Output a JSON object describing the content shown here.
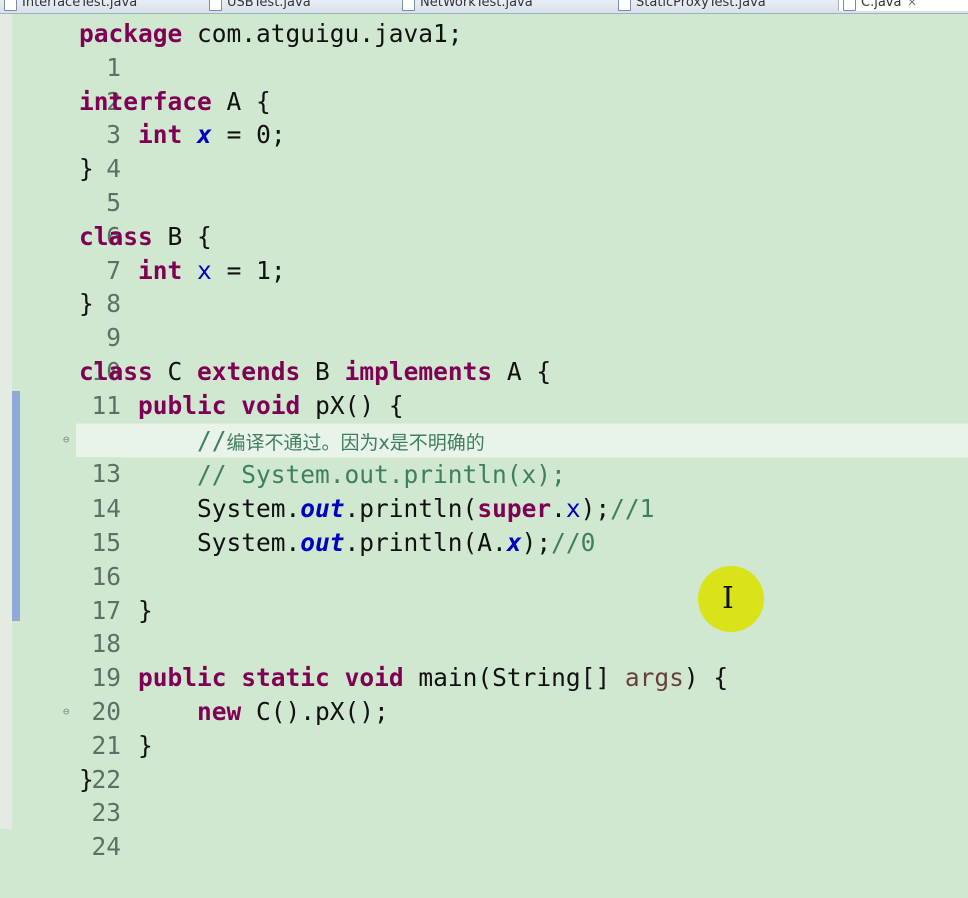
{
  "tabs": [
    {
      "label": "InterfaceTest.java",
      "active": false
    },
    {
      "label": "USBTest.java",
      "active": false
    },
    {
      "label": "NetWorkTest.java",
      "active": false
    },
    {
      "label": "StaticProxyTest.java",
      "active": false
    },
    {
      "label": "C.java",
      "active": true
    }
  ],
  "code": {
    "l1": {
      "num": "1",
      "a": "package",
      "b": " com.atguigu.java1;"
    },
    "l2": {
      "num": "2"
    },
    "l3": {
      "num": "3",
      "a": "interface",
      "b": " A {"
    },
    "l4": {
      "num": "4",
      "a": "int",
      "b": " ",
      "c": "x",
      "d": " = 0;"
    },
    "l5": {
      "num": "5",
      "a": "}"
    },
    "l6": {
      "num": "6"
    },
    "l7": {
      "num": "7",
      "a": "class",
      "b": " B {"
    },
    "l8": {
      "num": "8",
      "a": "int",
      "b": " ",
      "c": "x",
      "d": " = 1;"
    },
    "l9": {
      "num": "9",
      "a": "}"
    },
    "l10": {
      "num": "10"
    },
    "l11": {
      "num": "11",
      "a": "class",
      "b": " C ",
      "c": "extends",
      "d": " B ",
      "e": "implements",
      "f": " A {"
    },
    "l12": {
      "num": "12",
      "a": "public",
      "b": " ",
      "c": "void",
      "d": " pX() {"
    },
    "l13": {
      "num": "13",
      "a": "//",
      "b": "编译不通过。因为x是不明确的"
    },
    "l14": {
      "num": "14",
      "a": "// System.out.println(x);"
    },
    "l15": {
      "num": "15",
      "a": "System.",
      "b": "out",
      "c": ".println(",
      "d": "super",
      "e": ".",
      "f": "x",
      "g": ");",
      "h": "//1"
    },
    "l16": {
      "num": "16",
      "a": "System.",
      "b": "out",
      "c": ".println(A.",
      "d": "x",
      "e": ");",
      "f": "//0"
    },
    "l17": {
      "num": "17"
    },
    "l18": {
      "num": "18",
      "a": "}"
    },
    "l19": {
      "num": "19"
    },
    "l20": {
      "num": "20",
      "a": "public",
      "b": " ",
      "c": "static",
      "d": " ",
      "e": "void",
      "f": " main(String[] ",
      "g": "args",
      "h": ") {"
    },
    "l21": {
      "num": "21",
      "a": "new",
      "b": " C().pX();"
    },
    "l22": {
      "num": "22",
      "a": "}"
    },
    "l23": {
      "num": "23",
      "a": "}"
    },
    "l24": {
      "num": "24"
    }
  },
  "colors": {
    "background": "#cfe8cf",
    "keyword": "#7f0055",
    "field": "#0000c0",
    "comment": "#3f7f5f",
    "current_line": "#e8f3ea",
    "cursor_highlight": "#dce100"
  },
  "icons": {
    "fold_marker": "collapse-icon",
    "mouse_cursor": "ibeam-cursor-icon"
  }
}
